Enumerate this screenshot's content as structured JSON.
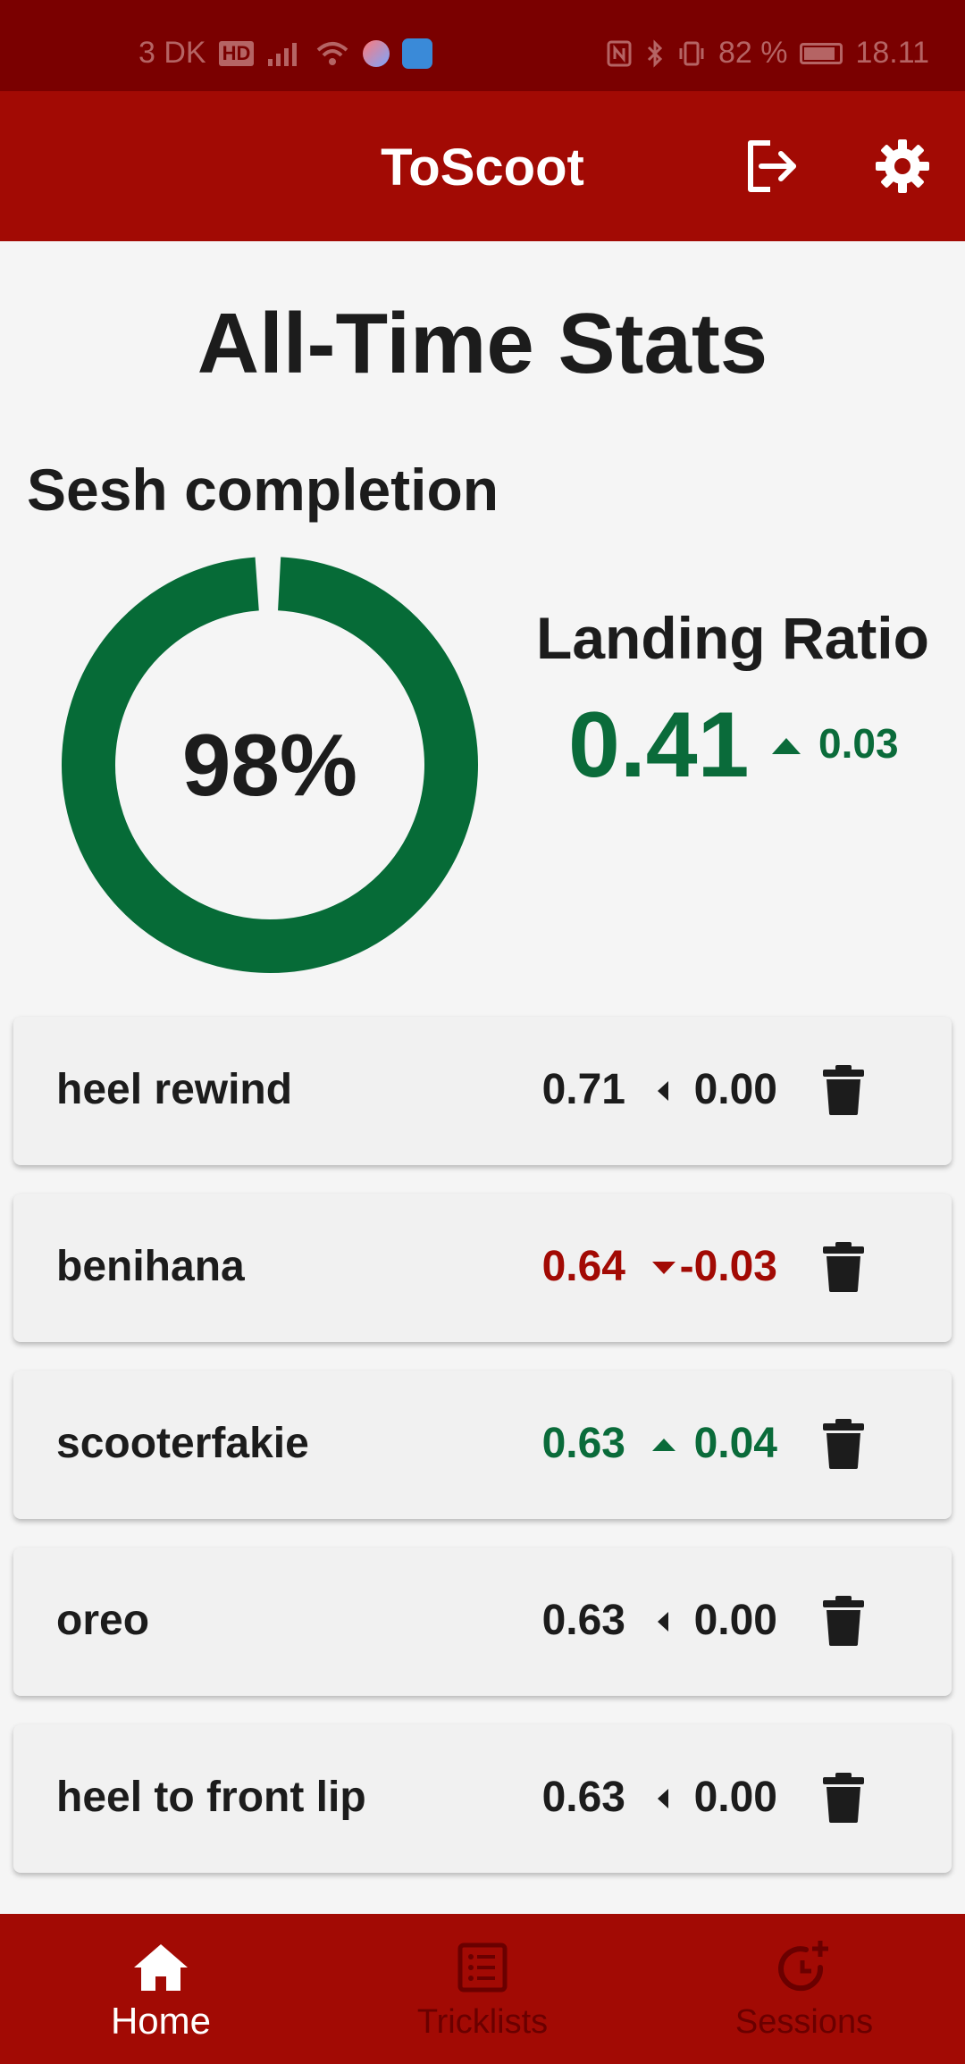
{
  "status_bar": {
    "network": "3 DK",
    "hd": "HD",
    "battery_pct": "82 %",
    "time": "18.11"
  },
  "app_bar": {
    "title": "ToScoot",
    "logout_icon": "logout-icon",
    "settings_icon": "gear-icon"
  },
  "page": {
    "title": "All-Time Stats",
    "sesh_label": "Sesh completion",
    "sesh_percent_text": "98%",
    "sesh_percent_value": 0.98,
    "landing_label": "Landing Ratio",
    "landing_value": "0.41",
    "landing_delta": "0.03",
    "landing_trend": "up"
  },
  "tricks": [
    {
      "name": "heel rewind",
      "ratio": "0.71",
      "delta": "0.00",
      "trend": "neutral"
    },
    {
      "name": "benihana",
      "ratio": "0.64",
      "delta": "-0.03",
      "trend": "down"
    },
    {
      "name": "scooterfakie",
      "ratio": "0.63",
      "delta": "0.04",
      "trend": "up"
    },
    {
      "name": "oreo",
      "ratio": "0.63",
      "delta": "0.00",
      "trend": "neutral"
    },
    {
      "name": "heel to front lip",
      "ratio": "0.63",
      "delta": "0.00",
      "trend": "neutral"
    }
  ],
  "bottom_nav": {
    "items": [
      {
        "label": "Home",
        "icon": "home-icon",
        "active": true
      },
      {
        "label": "Tricklists",
        "icon": "list-icon",
        "active": false
      },
      {
        "label": "Sessions",
        "icon": "history-add-icon",
        "active": false
      }
    ]
  },
  "colors": {
    "primary": "#a20a04",
    "status_bar": "#7a0000",
    "up": "#0a6b3a",
    "down": "#a20a04",
    "neutral": "#1c1c1c"
  }
}
